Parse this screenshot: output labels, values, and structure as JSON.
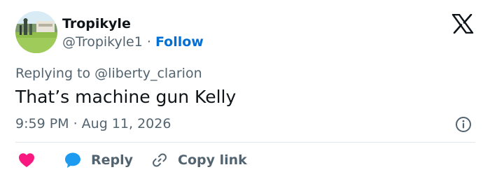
{
  "author": {
    "display_name": "Tropikyle",
    "handle": "@Tropikyle1",
    "separator": "·",
    "follow_label": "Follow"
  },
  "reply_context": {
    "prefix": "Replying to",
    "mention": "@liberty_clarion"
  },
  "tweet": {
    "text": "That’s machine gun Kelly",
    "timestamp": "9:59 PM · Aug 11, 2026"
  },
  "actions": {
    "reply_label": "Reply",
    "copy_label": "Copy link"
  },
  "icons": {
    "brand": "x-logo-icon",
    "info": "info-icon",
    "like": "heart-icon",
    "reply": "speech-bubble-icon",
    "copy": "link-icon"
  },
  "colors": {
    "text": "#0f1419",
    "secondary": "#536471",
    "follow": "#006fd6",
    "like": "#f91880",
    "reply": "#1d9bf0"
  }
}
